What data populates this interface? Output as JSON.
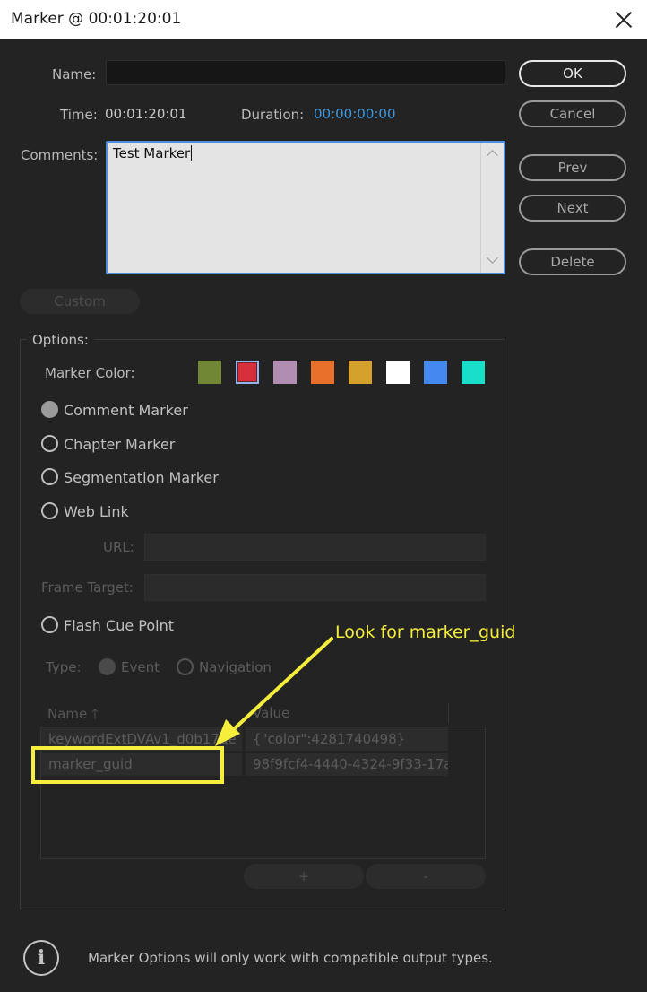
{
  "window": {
    "title": "Marker @ 00:01:20:01"
  },
  "fields": {
    "name_label": "Name:",
    "name_value": "",
    "time_label": "Time:",
    "time_value": "00:01:20:01",
    "duration_label": "Duration:",
    "duration_value": "00:00:00:00",
    "comments_label": "Comments:",
    "comments_value": "Test  Marker"
  },
  "buttons": {
    "ok": "OK",
    "cancel": "Cancel",
    "prev": "Prev",
    "next": "Next",
    "delete": "Delete",
    "custom": "Custom",
    "plus": "+",
    "minus": "-"
  },
  "options": {
    "legend": "Options:",
    "marker_color_label": "Marker Color:",
    "colors": [
      "#718735",
      "#d8303a",
      "#b28db2",
      "#e8702a",
      "#d5a12d",
      "#ffffff",
      "#4489f0",
      "#19dfc8"
    ],
    "selected_color_index": 1,
    "marker_types": [
      {
        "label": "Comment Marker",
        "checked": true
      },
      {
        "label": "Chapter Marker",
        "checked": false
      },
      {
        "label": "Segmentation Marker",
        "checked": false
      },
      {
        "label": "Web Link",
        "checked": false
      }
    ],
    "url_label": "URL:",
    "frame_target_label": "Frame Target:",
    "flash_cue_point_label": "Flash Cue Point",
    "type_label": "Type:",
    "type_options": [
      "Event",
      "Navigation"
    ]
  },
  "table": {
    "col_name": "Name",
    "col_value": "Value",
    "rows": [
      {
        "name": "keywordExtDVAv1_d0b17de",
        "value": "{\"color\":4281740498}"
      },
      {
        "name": "marker_guid",
        "value": "98f9fcf4-4440-4324-9f33-17a"
      }
    ]
  },
  "info": {
    "text": "Marker Options will only work with compatible output types."
  },
  "annotation": {
    "text": "Look for marker_guid",
    "color": "#f5ee3c"
  }
}
